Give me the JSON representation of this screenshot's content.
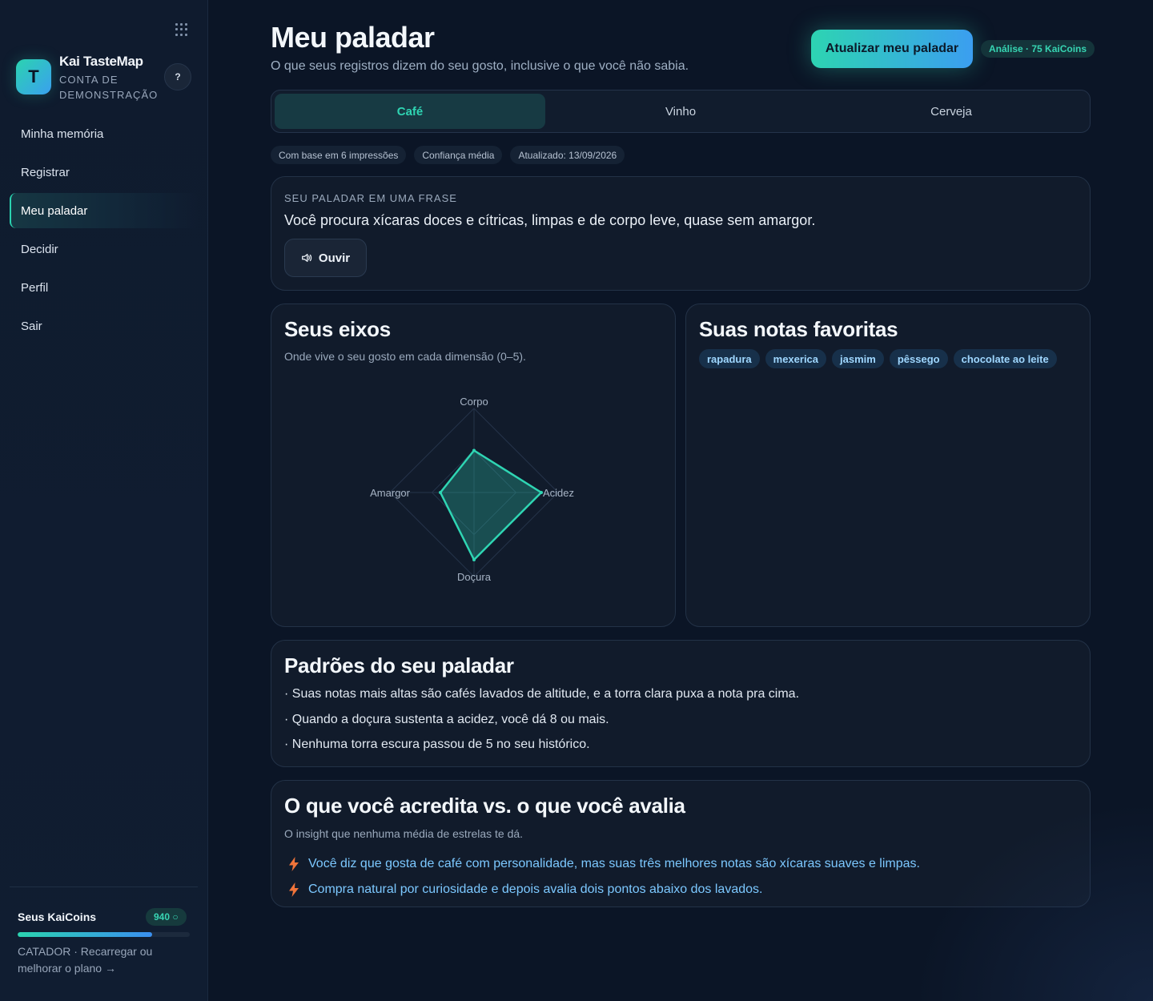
{
  "sidebar": {
    "brand": {
      "initial": "T",
      "name": "Kai TasteMap",
      "subtitle": "CONTA DE DEMONSTRAÇÃO"
    },
    "help_label": "?",
    "nav": [
      {
        "label": "Minha memória",
        "active": false
      },
      {
        "label": "Registrar",
        "active": false
      },
      {
        "label": "Meu paladar",
        "active": true
      },
      {
        "label": "Decidir",
        "active": false
      },
      {
        "label": "Perfil",
        "active": false
      },
      {
        "label": "Sair",
        "active": false
      }
    ],
    "coins": {
      "title": "Seus KaiCoins",
      "badge": "940 ○",
      "progress": 0.78,
      "plan_text": "CATADOR · Recarregar ou melhorar o plano →"
    }
  },
  "header": {
    "title": "Meu paladar",
    "subtitle": "O que seus registros dizem do seu gosto, inclusive o que você não sabia.",
    "update_button": "Atualizar meu paladar",
    "cost_badge": "Análise · 75 KaiCoins"
  },
  "tabs": [
    {
      "label": "Café",
      "active": true
    },
    {
      "label": "Vinho",
      "active": false
    },
    {
      "label": "Cerveja",
      "active": false
    }
  ],
  "chips": [
    "Com base em 6 impressões",
    "Confiança média",
    "Atualizado: 13/09/2026"
  ],
  "phrase": {
    "label": "SEU PALADAR EM UMA FRASE",
    "text": "Você procura xícaras doces e cítricas, limpas e de corpo leve, quase sem amargor.",
    "listen_button": "Ouvir"
  },
  "axes": {
    "title": "Seus eixos",
    "subtitle": "Onde vive o seu gosto em cada dimensão (0–5).",
    "labels": {
      "top": "Corpo",
      "right": "Acidez",
      "bottom": "Doçura",
      "left": "Amargor"
    }
  },
  "chart_data": {
    "type": "radar",
    "axes": [
      "Corpo",
      "Acidez",
      "Doçura",
      "Amargor"
    ],
    "values": [
      2.5,
      4,
      4,
      2
    ],
    "range": [
      0,
      5
    ],
    "color": "#2fd5b3"
  },
  "notes": {
    "title": "Suas notas favoritas",
    "items": [
      "rapadura",
      "mexerica",
      "jasmim",
      "pêssego",
      "chocolate ao leite"
    ]
  },
  "patterns": {
    "title": "Padrões do seu paladar",
    "items": [
      "· Suas notas mais altas são cafés lavados de altitude, e a torra clara puxa a nota pra cima.",
      "· Quando a doçura sustenta a acidez, você dá 8 ou mais.",
      "· Nenhuma torra escura passou de 5 no seu histórico."
    ]
  },
  "belief": {
    "title": "O que você acredita vs. o que você avalia",
    "subtitle": "O insight que nenhuma média de estrelas te dá.",
    "items": [
      "Você diz que gosta de café com personalidade, mas suas três melhores notas são xícaras suaves e limpas.",
      "Compra natural por curiosidade e depois avalia dois pontos abaixo dos lavados."
    ],
    "icon": "bolt-icon"
  }
}
